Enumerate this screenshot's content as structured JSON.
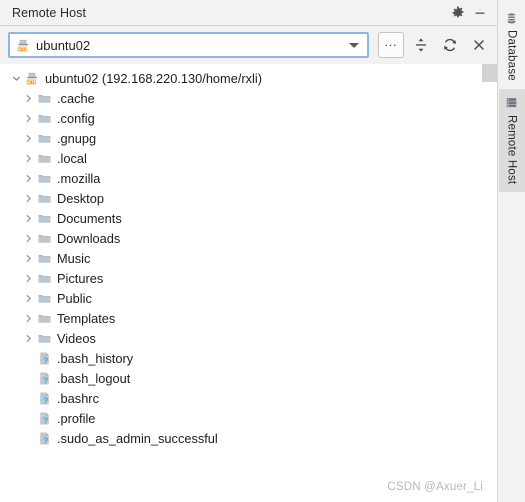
{
  "window": {
    "title": "Remote Host",
    "settings_icon": "gear-icon",
    "minimize_icon": "minimize-icon"
  },
  "toolbar": {
    "connection_value": "ubuntu02",
    "connection_icon": "sftp-server-icon",
    "dropdown_icon": "chevron-down-icon",
    "browse_label": "...",
    "collapse_all_icon": "collapse-all-icon",
    "refresh_icon": "refresh-icon",
    "close_icon": "close-icon"
  },
  "tree": {
    "root": {
      "label": "ubuntu02 (192.168.220.130/home/rxli)",
      "icon": "sftp-server-icon",
      "expanded": true
    },
    "items": [
      {
        "label": ".cache",
        "type": "folder",
        "expanded": false
      },
      {
        "label": ".config",
        "type": "folder",
        "expanded": false
      },
      {
        "label": ".gnupg",
        "type": "folder",
        "expanded": false
      },
      {
        "label": ".local",
        "type": "folder",
        "expanded": false
      },
      {
        "label": ".mozilla",
        "type": "folder",
        "expanded": false
      },
      {
        "label": "Desktop",
        "type": "folder",
        "expanded": false
      },
      {
        "label": "Documents",
        "type": "folder",
        "expanded": false
      },
      {
        "label": "Downloads",
        "type": "folder",
        "expanded": false
      },
      {
        "label": "Music",
        "type": "folder",
        "expanded": false
      },
      {
        "label": "Pictures",
        "type": "folder",
        "expanded": false
      },
      {
        "label": "Public",
        "type": "folder",
        "expanded": false
      },
      {
        "label": "Templates",
        "type": "folder",
        "expanded": false
      },
      {
        "label": "Videos",
        "type": "folder",
        "expanded": false
      },
      {
        "label": ".bash_history",
        "type": "file",
        "expanded": false
      },
      {
        "label": ".bash_logout",
        "type": "file",
        "expanded": false
      },
      {
        "label": ".bashrc",
        "type": "file",
        "expanded": false
      },
      {
        "label": ".profile",
        "type": "file",
        "expanded": false
      },
      {
        "label": ".sudo_as_admin_successful",
        "type": "file",
        "expanded": false
      }
    ]
  },
  "side_tabs": [
    {
      "label": "Database",
      "icon": "database-icon",
      "selected": false
    },
    {
      "label": "Remote Host",
      "icon": "remote-host-icon",
      "selected": true
    }
  ],
  "watermark": "CSDN @Axuer_Li",
  "colors": {
    "header_bg": "#f2f2f2",
    "panel_bg": "#ffffff",
    "focus_border": "#8cb7e2",
    "text": "#1d1d1d",
    "folder": "#a9b6c0",
    "sftp_accent": "#e8820c",
    "selected_tab_bg": "#dcdcdc",
    "watermark": "#b9b9b9"
  }
}
